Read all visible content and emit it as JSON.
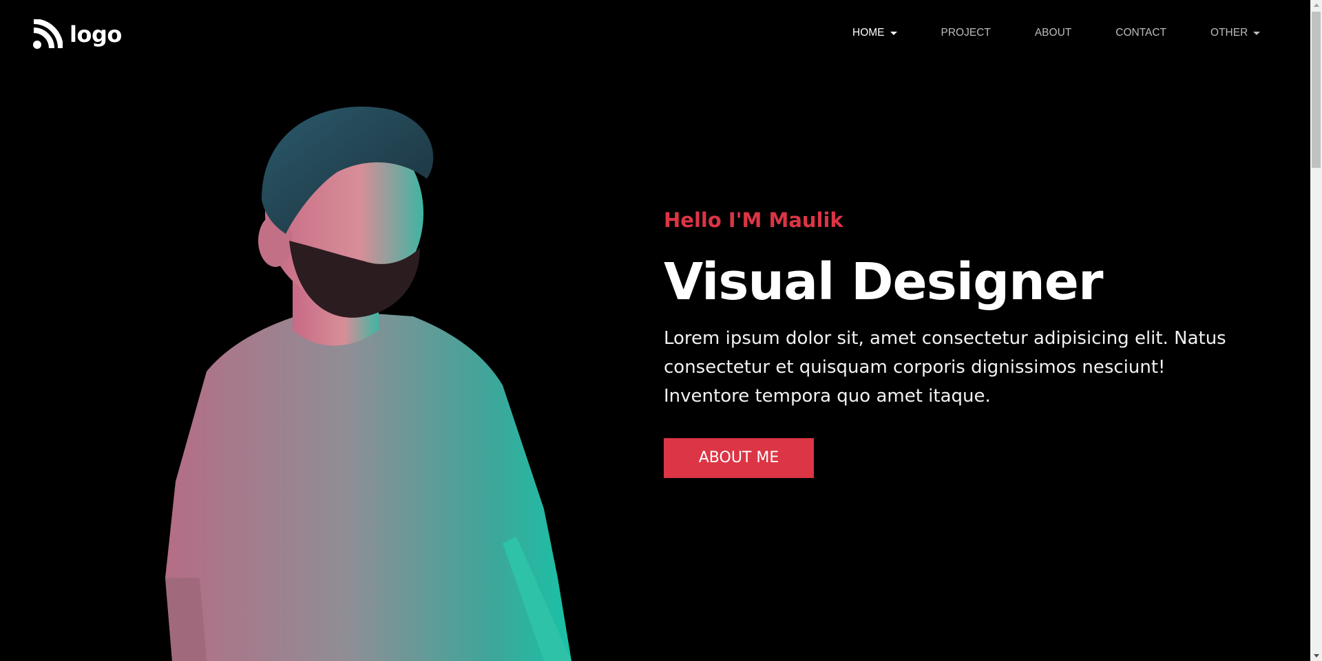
{
  "brand": {
    "logo_text": "logo",
    "logo_icon": "rss-feed-icon"
  },
  "nav": {
    "items": [
      {
        "label": "HOME",
        "active": true,
        "dropdown": true
      },
      {
        "label": "PROJECT",
        "active": false,
        "dropdown": false
      },
      {
        "label": "ABOUT",
        "active": false,
        "dropdown": false
      },
      {
        "label": "CONTACT",
        "active": false,
        "dropdown": false
      },
      {
        "label": "OTHER",
        "active": false,
        "dropdown": true
      }
    ]
  },
  "hero": {
    "greeting": "Hello I'M Maulik",
    "title": "Visual Designer",
    "description": "Lorem ipsum dolor sit, amet consectetur adipisicing elit. Natus consectetur et quisquam corporis dignissimos nesciunt! Inventore tempora quo amet itaque.",
    "cta_label": "ABOUT ME"
  },
  "colors": {
    "background": "#000000",
    "accent": "#dc3545",
    "text": "#ffffff",
    "nav_text": "#bdbdbd"
  }
}
